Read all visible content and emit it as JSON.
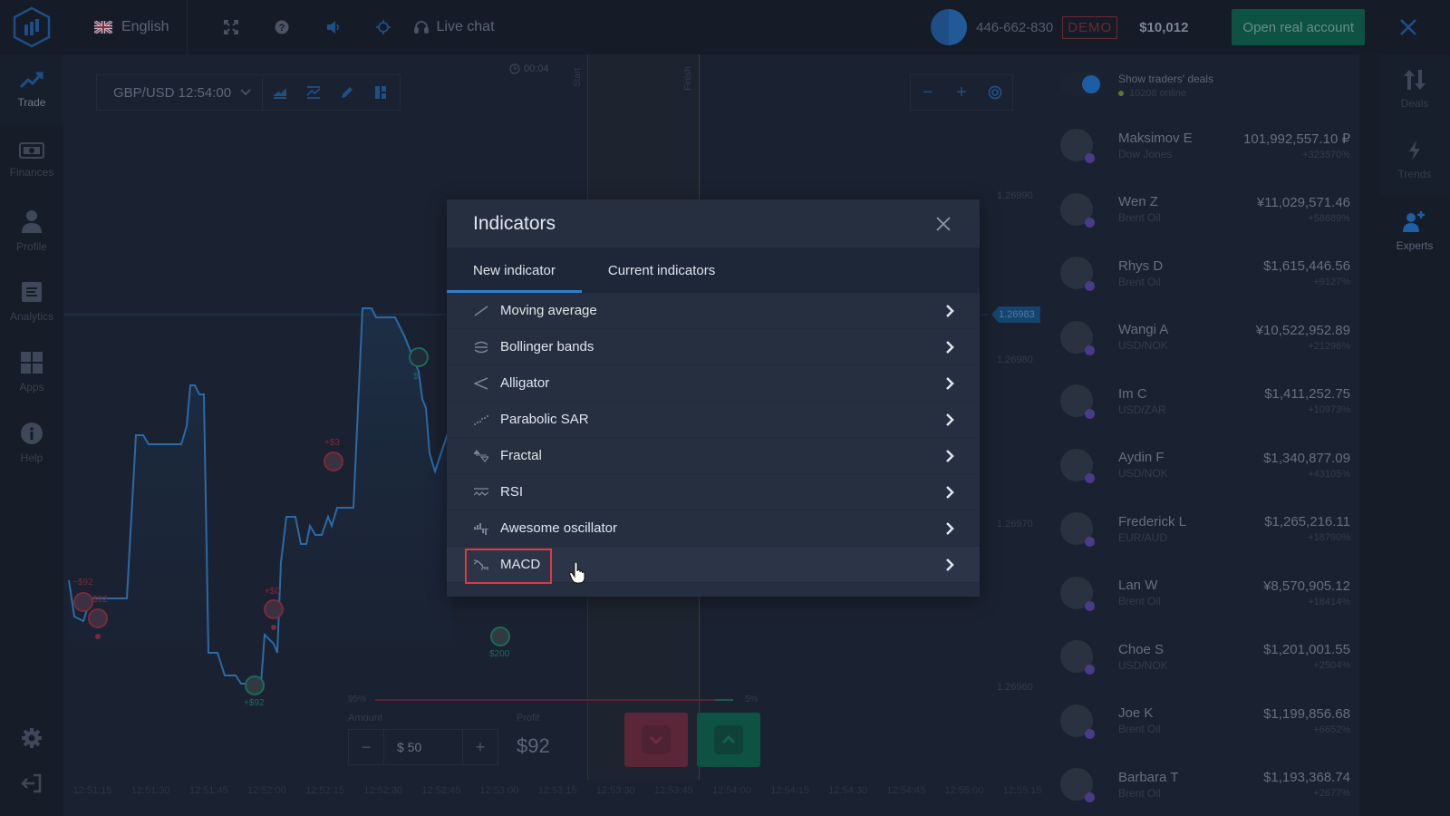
{
  "topbar": {
    "logo_icon": "logo-hex-bars-icon",
    "language": "English",
    "language_flag": "uk-flag-icon",
    "icons": [
      "fullscreen-icon",
      "help-icon",
      "sound-icon",
      "target-icon"
    ],
    "live_chat": "Live chat",
    "account_id": "446-662-830",
    "demo_badge": "DEMO",
    "balance": "$10,012",
    "open_real_account": "Open real account",
    "close_icon": "close-icon"
  },
  "left_sidebar": {
    "items": [
      {
        "label": "Trade",
        "icon": "trend-up-icon",
        "active": true
      },
      {
        "label": "Finances",
        "icon": "banknote-icon",
        "active": false
      },
      {
        "label": "Profile",
        "icon": "user-icon",
        "active": false
      },
      {
        "label": "Analytics",
        "icon": "document-icon",
        "active": false
      },
      {
        "label": "Apps",
        "icon": "grid-icon",
        "active": false
      },
      {
        "label": "Help",
        "icon": "info-icon",
        "active": false
      }
    ],
    "bottom_icons": [
      "settings-icon",
      "logout-icon"
    ]
  },
  "chart": {
    "asset": "GBP/USD 12:54:00",
    "tools": [
      "chart-type-icon",
      "indicators-icon",
      "drawing-icon",
      "layout-icon"
    ],
    "timer": "00:04",
    "start_label": "Start",
    "finish_label": "Finish",
    "zoom": {
      "minus": "−",
      "plus": "+",
      "reset_icon": "target-icon"
    },
    "price_levels": [
      "1.26990",
      "1.26980",
      "1.26970",
      "1.26960"
    ],
    "current_price": "1.26983",
    "time_axis": [
      "12:51:15",
      "12:51:30",
      "12:51:45",
      "12:52:00",
      "12:52:15",
      "12:52:30",
      "12:52:45",
      "12:53:00",
      "12:53:15",
      "12:53:30",
      "12:53:45",
      "12:54:00",
      "12:54:15",
      "12:54:30",
      "12:54:45",
      "12:55:00",
      "12:55:15"
    ],
    "deal_markers": [
      {
        "label": "−$92",
        "color": "#7a2a3c"
      },
      {
        "label": "$92",
        "color": "#7a2a3c"
      },
      {
        "label": "+$92",
        "color": "#1c6a5c"
      },
      {
        "label": "+$0",
        "color": "#7a2a3c"
      },
      {
        "label": "+$3",
        "color": "#7a2a3c"
      },
      {
        "label": "$200",
        "color": "#1c6a5c"
      },
      {
        "label": "$",
        "color": "#1c6a5c"
      }
    ]
  },
  "trade_panel": {
    "down_percent": "95%",
    "up_percent": "5%",
    "up_fraction": 0.05,
    "amount_label": "Amount",
    "amount_value": "$ 50",
    "minus": "−",
    "plus": "+",
    "profit_label": "Profit",
    "profit_value": "$92",
    "down_icon": "chevron-down-icon",
    "up_icon": "chevron-up-icon"
  },
  "traders_panel": {
    "toggle_label": "Show traders' deals",
    "online": "10208 online",
    "toggle_on": true,
    "traders": [
      {
        "name": "Maksimov E",
        "asset": "Dow Jones",
        "amount": "101,992,557.10 ₽",
        "pct": "+323570%"
      },
      {
        "name": "Wen Z",
        "asset": "Brent Oil",
        "amount": "¥11,029,571.46",
        "pct": "+58689%"
      },
      {
        "name": "Rhys D",
        "asset": "Brent Oil",
        "amount": "$1,615,446.56",
        "pct": "+9127%"
      },
      {
        "name": "Wangi A",
        "asset": "USD/NOK",
        "amount": "¥10,522,952.89",
        "pct": "+21296%"
      },
      {
        "name": "Im C",
        "asset": "USD/ZAR",
        "amount": "$1,411,252.75",
        "pct": "+10973%"
      },
      {
        "name": "Aydin F",
        "asset": "USD/NOK",
        "amount": "$1,340,877.09",
        "pct": "+43105%"
      },
      {
        "name": "Frederick L",
        "asset": "EUR/AUD",
        "amount": "$1,265,216.11",
        "pct": "+18790%"
      },
      {
        "name": "Lan W",
        "asset": "Brent Oil",
        "amount": "¥8,570,905.12",
        "pct": "+18414%"
      },
      {
        "name": "Choe S",
        "asset": "USD/NOK",
        "amount": "$1,201,001.55",
        "pct": "+2504%"
      },
      {
        "name": "Joe K",
        "asset": "Brent Oil",
        "amount": "$1,199,856.68",
        "pct": "+6652%"
      },
      {
        "name": "Barbara T",
        "asset": "Brent Oil",
        "amount": "$1,193,368.74",
        "pct": "+2677%"
      }
    ]
  },
  "right_rail": {
    "items": [
      {
        "label": "Deals",
        "icon": "up-down-arrows-icon"
      },
      {
        "label": "Trends",
        "icon": "lightning-icon"
      },
      {
        "label": "Experts",
        "icon": "add-user-icon",
        "active": true
      }
    ]
  },
  "modal": {
    "title": "Indicators",
    "close_icon": "close-icon",
    "tabs": [
      {
        "label": "New indicator",
        "active": true
      },
      {
        "label": "Current indicators",
        "active": false
      }
    ],
    "indicators": [
      {
        "label": "Moving average",
        "icon": "moving-average-icon"
      },
      {
        "label": "Bollinger bands",
        "icon": "bollinger-bands-icon"
      },
      {
        "label": "Alligator",
        "icon": "alligator-icon"
      },
      {
        "label": "Parabolic SAR",
        "icon": "parabolic-sar-icon"
      },
      {
        "label": "Fractal",
        "icon": "fractal-icon"
      },
      {
        "label": "RSI",
        "icon": "rsi-icon"
      },
      {
        "label": "Awesome oscillator",
        "icon": "awesome-oscillator-icon"
      },
      {
        "label": "MACD",
        "icon": "macd-icon",
        "highlighted": true
      }
    ]
  },
  "colors": {
    "accent_blue": "#2f7fd0",
    "highlight_red": "#e0393f",
    "up_green": "#0d5242",
    "down_red": "#5b2637"
  }
}
